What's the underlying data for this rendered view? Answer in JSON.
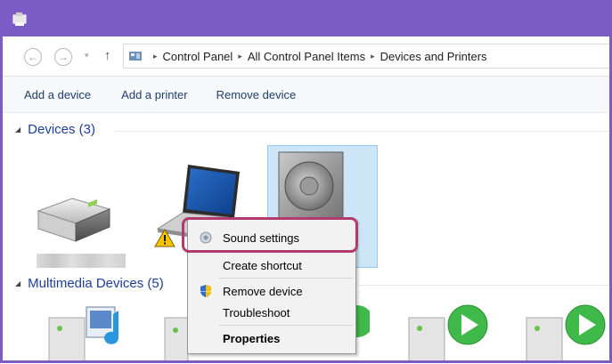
{
  "breadcrumb": [
    "Control Panel",
    "All Control Panel Items",
    "Devices and Printers"
  ],
  "commands": [
    "Add a device",
    "Add a printer",
    "Remove device"
  ],
  "groups": {
    "devices": "Devices (3)",
    "multimedia": "Multimedia Devices (5)"
  },
  "context_menu": {
    "sound_settings": "Sound settings",
    "create_shortcut": "Create shortcut",
    "remove_device": "Remove device",
    "troubleshoot": "Troubleshoot",
    "properties": "Properties"
  },
  "icons": {
    "back": "←",
    "forward": "→",
    "dropdown": "▾",
    "up": "↑",
    "breadcrumb_sep": "▸",
    "expand": "◢"
  },
  "colors": {
    "titlebar": "#7b5cc6",
    "highlight_box": "#b23a6e",
    "selection": "#cde6f7",
    "group_header": "#1e3e9e"
  }
}
